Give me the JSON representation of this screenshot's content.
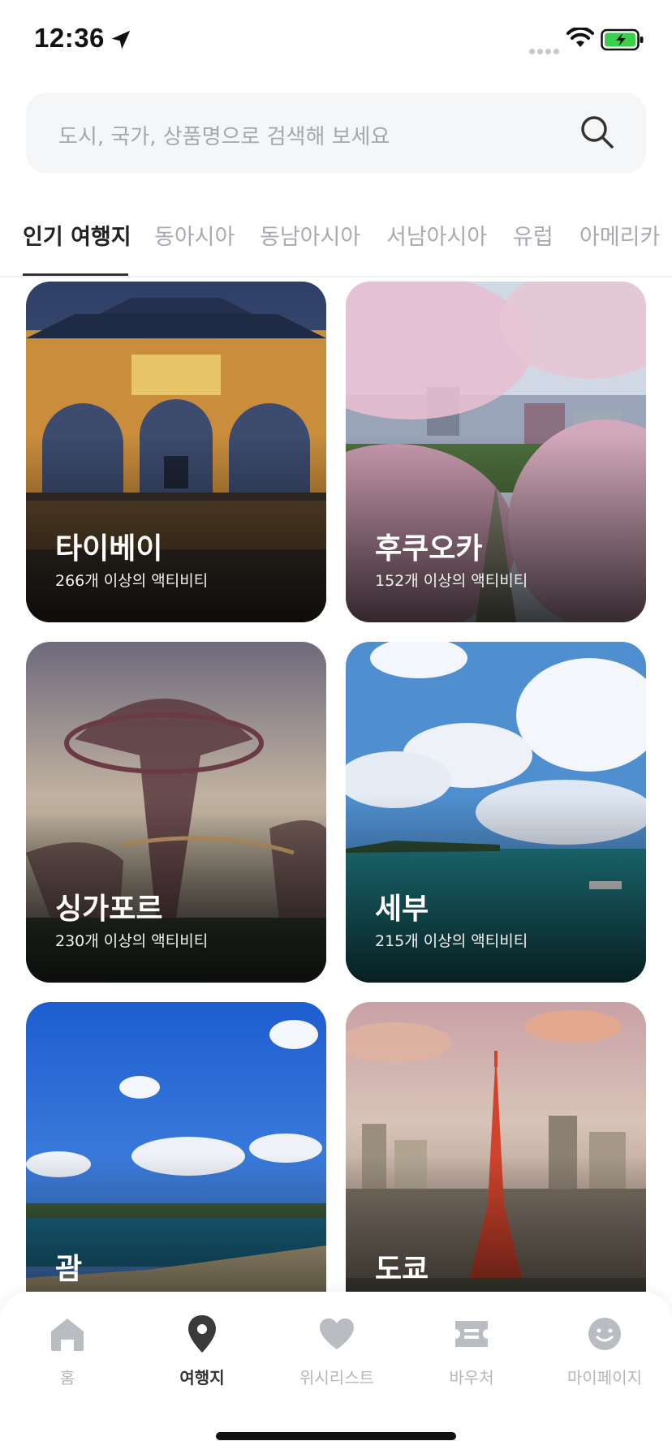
{
  "status_bar": {
    "time": "12:36",
    "icons": [
      "location-arrow-icon",
      "signal-dots-icon",
      "wifi-icon",
      "battery-charging-icon"
    ],
    "battery_color": "#3ccf4e"
  },
  "search": {
    "placeholder": "도시, 국가, 상품명으로 검색해 보세요",
    "icon": "search-icon"
  },
  "tabs": [
    {
      "label": "인기 여행지",
      "active": true
    },
    {
      "label": "동아시아",
      "active": false
    },
    {
      "label": "동남아시아",
      "active": false
    },
    {
      "label": "서남아시아",
      "active": false
    },
    {
      "label": "유럽",
      "active": false
    },
    {
      "label": "아메리카",
      "active": false
    }
  ],
  "destinations": [
    {
      "name": "타이베이",
      "count": "266개 이상의 액티비티"
    },
    {
      "name": "후쿠오카",
      "count": "152개 이상의 액티비티"
    },
    {
      "name": "싱가포르",
      "count": "230개 이상의 액티비티"
    },
    {
      "name": "세부",
      "count": "215개 이상의 액티비티"
    },
    {
      "name": "괌",
      "count": ""
    },
    {
      "name": "도쿄",
      "count": ""
    }
  ],
  "bottom_nav": [
    {
      "label": "홈",
      "icon": "home-icon",
      "active": false
    },
    {
      "label": "여행지",
      "icon": "map-pin-icon",
      "active": true
    },
    {
      "label": "위시리스트",
      "icon": "heart-icon",
      "active": false
    },
    {
      "label": "바우처",
      "icon": "ticket-icon",
      "active": false
    },
    {
      "label": "마이페이지",
      "icon": "smiley-icon",
      "active": false
    }
  ],
  "colors": {
    "active_text": "#222222",
    "inactive_text": "#a7abb0",
    "search_bg": "#f5f6f8"
  }
}
